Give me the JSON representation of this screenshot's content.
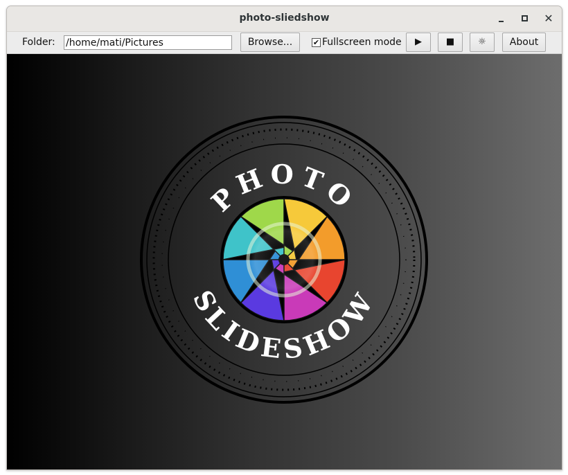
{
  "window": {
    "title": "photo-sliedshow"
  },
  "titlebar": {
    "minimize_glyph": "",
    "maximize_glyph": "",
    "close_glyph": "✕"
  },
  "toolbar": {
    "folder_label": "Folder:",
    "folder_value": "/home/mati/Pictures",
    "browse_label": "Browse...",
    "fullscreen_label": "Fullscreen mode",
    "fullscreen_checked": true,
    "checkmark": "✔",
    "play_glyph": "▶",
    "stop_glyph": "■",
    "settings_glyph": "☼",
    "about_label": "About"
  },
  "logo": {
    "top_text": "PHOTO",
    "bottom_text": "SLIDESHOW",
    "icon": "camera-aperture-icon"
  },
  "colors": {
    "viewer_gradient_start": "#000000",
    "viewer_gradient_end": "#6d6d6d",
    "logo_ring": "#000000",
    "logo_text": "#ffffff"
  }
}
